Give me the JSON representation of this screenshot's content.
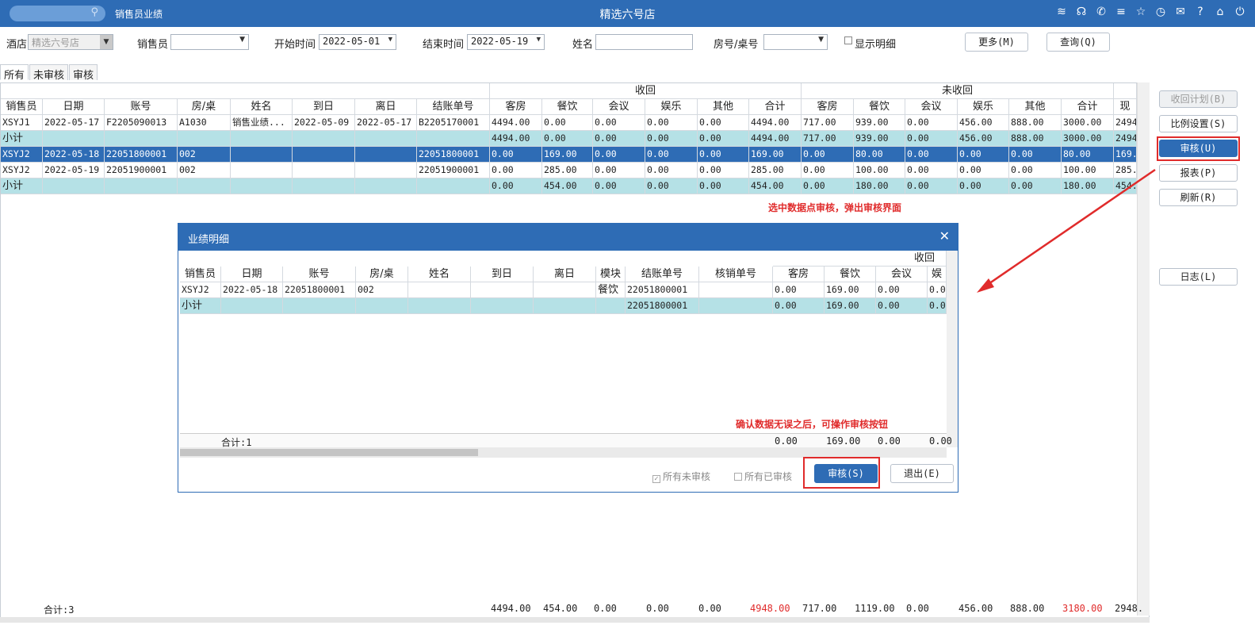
{
  "titlebar": {
    "module": "销售员业绩",
    "hotel": "精选六号店",
    "icons": [
      "wifi-icon",
      "headset-icon",
      "phone-icon",
      "menu-icon",
      "star-icon",
      "clock-icon",
      "mail-icon",
      "help-icon",
      "home-icon",
      "power-icon"
    ],
    "icon_glyphs": [
      "≋",
      "☊",
      "✆",
      "≡",
      "☆",
      "◷",
      "✉",
      "?",
      "⌂",
      "⏻"
    ]
  },
  "filters": {
    "hotel_label": "酒店",
    "hotel_value": "精选六号店",
    "salesperson_label": "销售员",
    "salesperson_value": "",
    "start_label": "开始时间",
    "start_value": "2022-05-01",
    "end_label": "结束时间",
    "end_value": "2022-05-19",
    "name_label": "姓名",
    "name_value": "",
    "room_label": "房号/桌号",
    "room_value": "",
    "detail_label": "显示明细",
    "more_button": "更多(M)",
    "query_button": "查询(Q)"
  },
  "tabs": [
    "所有",
    "未审核",
    "审核"
  ],
  "grid": {
    "group_headers": [
      "收回",
      "未收回"
    ],
    "columns": [
      "销售员",
      "日期",
      "账号",
      "房/桌",
      "姓名",
      "到日",
      "离日",
      "结账单号",
      "客房",
      "餐饮",
      "会议",
      "娱乐",
      "其他",
      "合计",
      "客房",
      "餐饮",
      "会议",
      "娱乐",
      "其他",
      "合计",
      "现"
    ],
    "rows": [
      {
        "type": "data",
        "cells": [
          "XSYJ1",
          "2022-05-17",
          "F2205090013",
          "A1030",
          "销售业绩...",
          "2022-05-09",
          "2022-05-17",
          "B2205170001",
          "4494.00",
          "0.00",
          "0.00",
          "0.00",
          "0.00",
          "4494.00",
          "717.00",
          "939.00",
          "0.00",
          "456.00",
          "888.00",
          "3000.00",
          "2494."
        ]
      },
      {
        "type": "sub",
        "cells": [
          "小计",
          "",
          "",
          "",
          "",
          "",
          "",
          "",
          "4494.00",
          "0.00",
          "0.00",
          "0.00",
          "0.00",
          "4494.00",
          "717.00",
          "939.00",
          "0.00",
          "456.00",
          "888.00",
          "3000.00",
          "2494."
        ]
      },
      {
        "type": "sel",
        "cells": [
          "XSYJ2",
          "2022-05-18",
          "22051800001",
          "002",
          "",
          "",
          "",
          "22051800001",
          "0.00",
          "169.00",
          "0.00",
          "0.00",
          "0.00",
          "169.00",
          "0.00",
          "80.00",
          "0.00",
          "0.00",
          "0.00",
          "80.00",
          "169."
        ]
      },
      {
        "type": "data",
        "cells": [
          "XSYJ2",
          "2022-05-19",
          "22051900001",
          "002",
          "",
          "",
          "",
          "22051900001",
          "0.00",
          "285.00",
          "0.00",
          "0.00",
          "0.00",
          "285.00",
          "0.00",
          "100.00",
          "0.00",
          "0.00",
          "0.00",
          "100.00",
          "285."
        ]
      },
      {
        "type": "sub",
        "cells": [
          "小计",
          "",
          "",
          "",
          "",
          "",
          "",
          "",
          "0.00",
          "454.00",
          "0.00",
          "0.00",
          "0.00",
          "454.00",
          "0.00",
          "180.00",
          "0.00",
          "0.00",
          "0.00",
          "180.00",
          "454."
        ]
      }
    ],
    "total_label": "合计:3",
    "totals": [
      "4494.00",
      "454.00",
      "0.00",
      "0.00",
      "0.00",
      "4948.00",
      "717.00",
      "1119.00",
      "0.00",
      "456.00",
      "888.00",
      "3180.00",
      "2948."
    ]
  },
  "right_buttons": [
    "收回计划(B)",
    "比例设置(S)",
    "审核(U)",
    "报表(P)",
    "刷新(R)",
    "日志(L)"
  ],
  "annotations": {
    "top": "选中数据点审核，弹出审核界面",
    "dialog": "确认数据无误之后，可操作审核按钮"
  },
  "dialog": {
    "title": "业绩明细",
    "group_header": "收回",
    "columns": [
      "销售员",
      "日期",
      "账号",
      "房/桌",
      "姓名",
      "到日",
      "离日",
      "模块",
      "结账单号",
      "核销单号",
      "客房",
      "餐饮",
      "会议",
      "娱"
    ],
    "rows": [
      {
        "type": "data",
        "cells": [
          "XSYJ2",
          "2022-05-18",
          "22051800001",
          "002",
          "",
          "",
          "",
          "餐饮",
          "22051800001",
          "",
          "0.00",
          "169.00",
          "0.00",
          "0.00"
        ]
      },
      {
        "type": "sub",
        "cells": [
          "小计",
          "",
          "",
          "",
          "",
          "",
          "",
          "",
          "22051800001",
          "",
          "0.00",
          "169.00",
          "0.00",
          "0.00"
        ]
      }
    ],
    "total_label": "合计:1",
    "totals": [
      "0.00",
      "169.00",
      "0.00",
      "0.00"
    ],
    "all_unaudited": "所有未审核",
    "all_audited": "所有已审核",
    "audit_button": "审核(S)",
    "exit_button": "退出(E)"
  },
  "colors": {
    "accent": "#2e6cb5",
    "subtotal": "#b5e1e6",
    "annotation": "#e02b2b"
  }
}
